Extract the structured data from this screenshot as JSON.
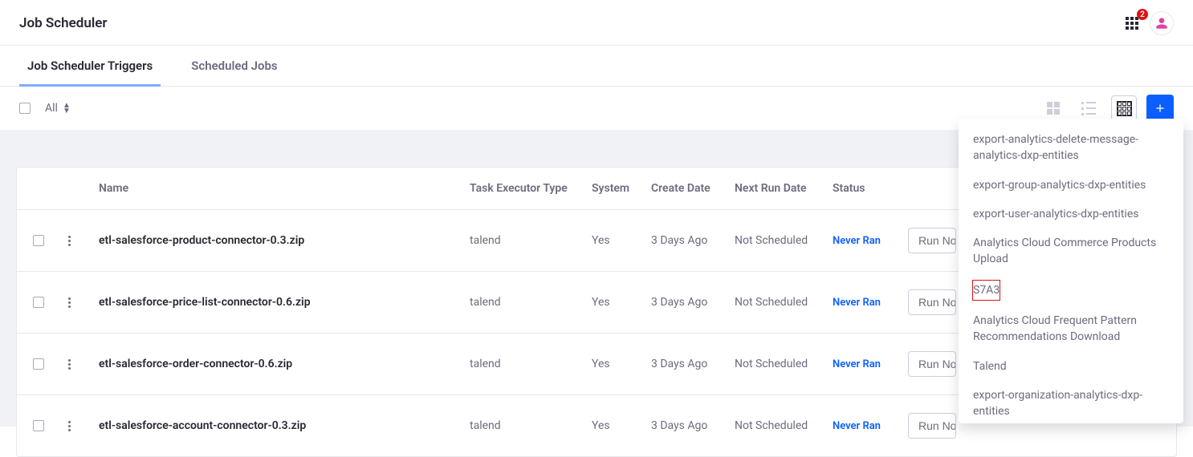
{
  "header": {
    "title": "Job Scheduler",
    "notification_count": "2"
  },
  "tabs": [
    {
      "label": "Job Scheduler Triggers",
      "active": true
    },
    {
      "label": "Scheduled Jobs",
      "active": false
    }
  ],
  "toolbar": {
    "filter_label": "All"
  },
  "table": {
    "columns": {
      "name": "Name",
      "type": "Task Executor Type",
      "system": "System",
      "create": "Create Date",
      "next": "Next Run Date",
      "status": "Status"
    },
    "rows": [
      {
        "name": "etl-salesforce-product-connector-0.3.zip",
        "type": "talend",
        "system": "Yes",
        "create": "3 Days Ago",
        "next": "Not Scheduled",
        "status": "Never Ran",
        "run_label": "Run Now"
      },
      {
        "name": "etl-salesforce-price-list-connector-0.6.zip",
        "type": "talend",
        "system": "Yes",
        "create": "3 Days Ago",
        "next": "Not Scheduled",
        "status": "Never Ran",
        "run_label": "Run Now"
      },
      {
        "name": "etl-salesforce-order-connector-0.6.zip",
        "type": "talend",
        "system": "Yes",
        "create": "3 Days Ago",
        "next": "Not Scheduled",
        "status": "Never Ran",
        "run_label": "Run Now"
      },
      {
        "name": "etl-salesforce-account-connector-0.3.zip",
        "type": "talend",
        "system": "Yes",
        "create": "3 Days Ago",
        "next": "Not Scheduled",
        "status": "Never Ran",
        "run_label": "Run Now"
      }
    ]
  },
  "dropdown": {
    "items": [
      "export-analytics-delete-message-analytics-dxp-entities",
      "export-group-analytics-dxp-entities",
      "export-user-analytics-dxp-entities",
      "Analytics Cloud Commerce Products Upload",
      "S7A3",
      "Analytics Cloud Frequent Pattern Recommendations Download",
      "Talend",
      "export-organization-analytics-dxp-entities"
    ],
    "highlighted_index": 4
  }
}
